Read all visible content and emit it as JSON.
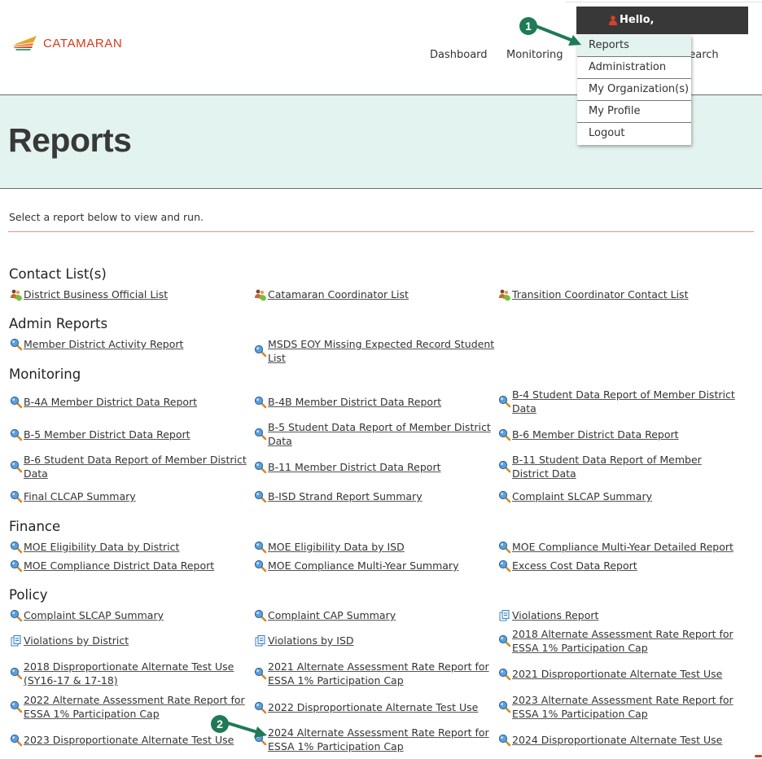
{
  "header": {
    "brand": "CATAMARAN",
    "nav": [
      "Dashboard",
      "Monitoring",
      "Search"
    ],
    "user_greeting": "Hello,",
    "user_menu": [
      "Reports",
      "Administration",
      "My Organization(s)",
      "My Profile",
      "Logout"
    ],
    "active_menu_item": "Reports"
  },
  "page": {
    "title": "Reports",
    "intro": "Select a report below to view and run."
  },
  "sections": [
    {
      "title": "Contact List(s)",
      "reports": [
        {
          "label": "District Business Official List",
          "icon": "contacts-icon"
        },
        {
          "label": "Catamaran Coordinator List",
          "icon": "contacts-icon"
        },
        {
          "label": "Transition Coordinator Contact List",
          "icon": "contacts-icon"
        }
      ]
    },
    {
      "title": "Admin Reports",
      "reports": [
        {
          "label": "Member District Activity Report",
          "icon": "magnifier-icon"
        },
        {
          "label": "MSDS EOY Missing Expected Record Student List",
          "icon": "magnifier-icon"
        }
      ]
    },
    {
      "title": "Monitoring",
      "reports": [
        {
          "label": "B-4A Member District Data Report",
          "icon": "magnifier-icon"
        },
        {
          "label": "B-4B Member District Data Report",
          "icon": "magnifier-icon"
        },
        {
          "label": "B-4 Student Data Report of Member District Data",
          "icon": "magnifier-icon"
        },
        {
          "label": "B-5 Member District Data Report",
          "icon": "magnifier-icon"
        },
        {
          "label": "B-5 Student Data Report of Member District Data",
          "icon": "magnifier-icon"
        },
        {
          "label": "B-6 Member District Data Report",
          "icon": "magnifier-icon"
        },
        {
          "label": "B-6 Student Data Report of Member District Data",
          "icon": "magnifier-icon"
        },
        {
          "label": "B-11 Member District Data Report",
          "icon": "magnifier-icon"
        },
        {
          "label": "B-11 Student Data Report of Member District Data",
          "icon": "magnifier-icon"
        },
        {
          "label": "Final CLCAP Summary",
          "icon": "magnifier-icon"
        },
        {
          "label": "B-ISD Strand Report Summary",
          "icon": "magnifier-icon"
        },
        {
          "label": "Complaint SLCAP Summary",
          "icon": "magnifier-icon"
        }
      ]
    },
    {
      "title": "Finance",
      "reports": [
        {
          "label": "MOE Eligibility Data by District",
          "icon": "magnifier-icon"
        },
        {
          "label": "MOE Eligibility Data by ISD",
          "icon": "magnifier-icon"
        },
        {
          "label": "MOE Compliance Multi-Year Detailed Report",
          "icon": "magnifier-icon"
        },
        {
          "label": "MOE Compliance District Data Report",
          "icon": "magnifier-icon"
        },
        {
          "label": "MOE Compliance Multi-Year Summary",
          "icon": "magnifier-icon"
        },
        {
          "label": "Excess Cost Data Report",
          "icon": "magnifier-icon"
        }
      ]
    },
    {
      "title": "Policy",
      "reports": [
        {
          "label": "Complaint SLCAP Summary",
          "icon": "magnifier-icon"
        },
        {
          "label": "Complaint CAP Summary",
          "icon": "magnifier-icon"
        },
        {
          "label": "Violations Report",
          "icon": "documents-icon"
        },
        {
          "label": "Violations by District",
          "icon": "documents-icon"
        },
        {
          "label": "Violations by ISD",
          "icon": "documents-icon"
        },
        {
          "label": "2018 Alternate Assessment Rate Report for ESSA 1% Participation Cap",
          "icon": "magnifier-icon"
        },
        {
          "label": "2018 Disproportionate Alternate Test Use (SY16-17 & 17-18)",
          "icon": "magnifier-icon"
        },
        {
          "label": "2021 Alternate Assessment Rate Report for ESSA 1% Participation Cap",
          "icon": "magnifier-icon"
        },
        {
          "label": "2021 Disproportionate Alternate Test Use",
          "icon": "magnifier-icon"
        },
        {
          "label": "2022 Alternate Assessment Rate Report for ESSA 1% Participation Cap",
          "icon": "magnifier-icon"
        },
        {
          "label": "2022 Disproportionate Alternate Test Use",
          "icon": "magnifier-icon"
        },
        {
          "label": "2023 Alternate Assessment Rate Report for ESSA 1% Participation Cap",
          "icon": "magnifier-icon"
        },
        {
          "label": "2023 Disproportionate Alternate Test Use",
          "icon": "magnifier-icon"
        },
        {
          "label": "2024 Alternate Assessment Rate Report for ESSA 1% Participation Cap",
          "icon": "magnifier-icon"
        },
        {
          "label": "2024 Disproportionate Alternate Test Use",
          "icon": "magnifier-icon"
        }
      ]
    }
  ],
  "annotations": [
    {
      "number": "1",
      "target": "Reports"
    },
    {
      "number": "2",
      "target": "2024 Alternate Assessment Rate Report for ESSA 1% Participation Cap"
    }
  ],
  "colors": {
    "brand": "#d23a1f",
    "title_band": "#e3f3ef",
    "user_bar": "#383838",
    "callout": "#1f7a56",
    "rule": "#e9968c"
  }
}
